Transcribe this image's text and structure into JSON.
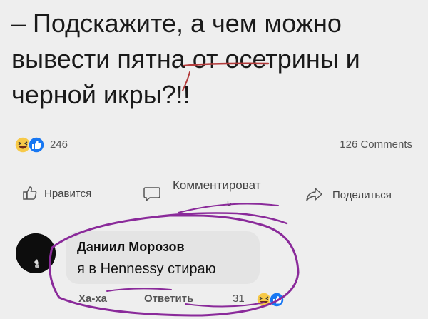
{
  "post": {
    "lines": [
      "– Подскажите, а чем можно",
      "вывести пятна от осетрины и",
      "черной икры?!!"
    ]
  },
  "stats": {
    "reactions_count": "246",
    "comments_count": "126 Comments",
    "reaction_icons": [
      "laugh-emoji-icon",
      "like-icon"
    ]
  },
  "actions": {
    "like_label": "Нравится",
    "comment_label": "Комментироват",
    "comment_label_tail": "ь",
    "share_label": "Поделиться"
  },
  "comment": {
    "author": "Даниил Морозов",
    "text": "я в Hennessy стираю",
    "laugh_label": "Ха-ха",
    "reply_label": "Ответить",
    "reactions_count": "31"
  },
  "colors": {
    "background": "#eeeeee",
    "bubble": "#e4e4e4",
    "annotation": "#8a2a9a",
    "underline": "#b33a3a",
    "like_blue": "#1877f2",
    "emoji_yellow": "#f7c948"
  }
}
